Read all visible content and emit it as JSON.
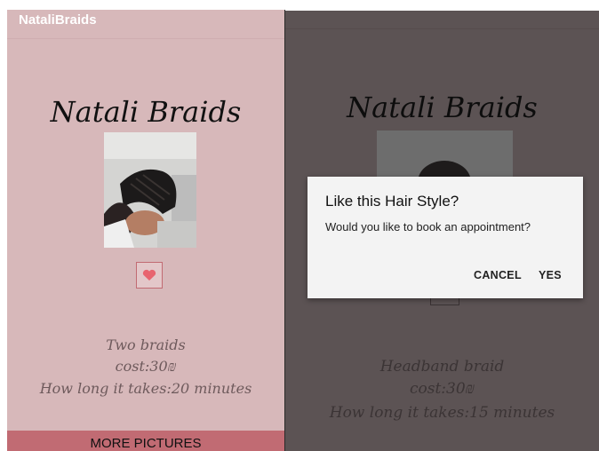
{
  "app": {
    "title": "NataliBraids"
  },
  "left": {
    "brand": "Natali Braids",
    "style_name": "Two braids",
    "cost": "cost:30₪",
    "duration": "How long it takes:20 minutes",
    "more_button": "MORE PICTURES"
  },
  "right": {
    "brand": "Natali Braids",
    "style_name": "Headband braid",
    "cost": "cost:30₪",
    "duration": "How long it takes:15 minutes"
  },
  "dialog": {
    "title": "Like this Hair Style?",
    "message": "Would you like to book an appointment?",
    "cancel": "CANCEL",
    "yes": "YES"
  },
  "colors": {
    "background_pink": "#d7b8ba",
    "button_rose": "#c16b73",
    "heart": "#e8646f",
    "scrim": "#5c5354"
  },
  "icons": {
    "favorite": "heart-icon"
  }
}
